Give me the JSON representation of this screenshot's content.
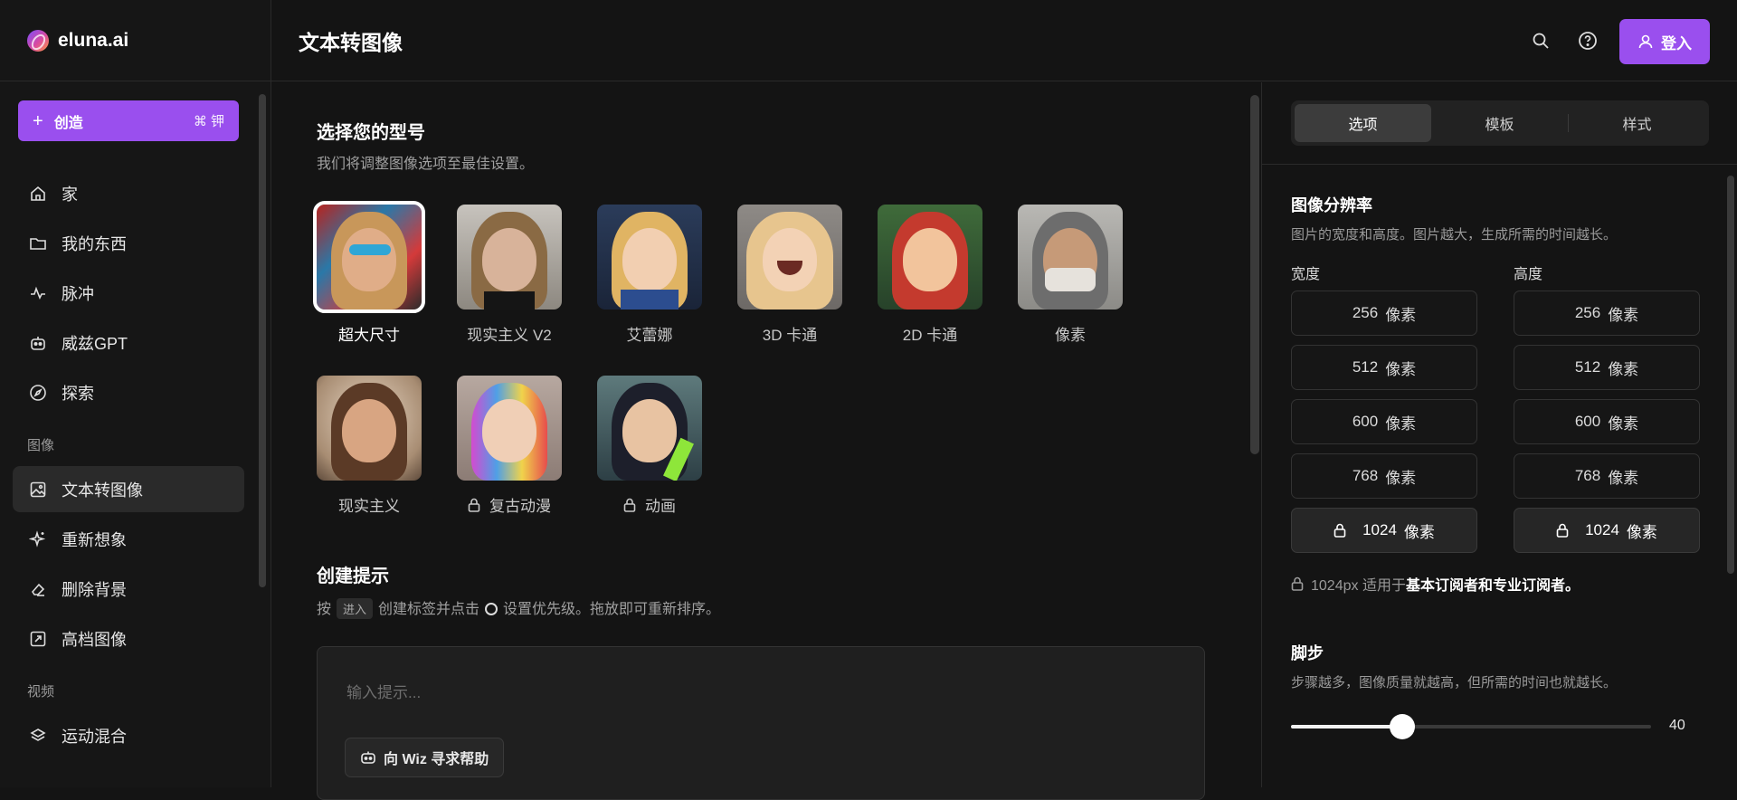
{
  "brand": {
    "name": "eluna.ai"
  },
  "header": {
    "title": "文本转图像",
    "login_label": "登入"
  },
  "sidebar": {
    "create_label": "创造",
    "create_shortcut": "⌘ 钾",
    "items": [
      {
        "label": "家",
        "icon": "home-icon"
      },
      {
        "label": "我的东西",
        "icon": "folder-icon"
      },
      {
        "label": "脉冲",
        "icon": "pulse-icon"
      },
      {
        "label": "威兹GPT",
        "icon": "robot-icon"
      },
      {
        "label": "探索",
        "icon": "compass-icon"
      }
    ],
    "section_image": "图像",
    "image_items": [
      {
        "label": "文本转图像",
        "icon": "image-icon",
        "active": true
      },
      {
        "label": "重新想象",
        "icon": "sparkle-icon"
      },
      {
        "label": "删除背景",
        "icon": "eraser-icon"
      },
      {
        "label": "高档图像",
        "icon": "upscale-icon"
      }
    ],
    "section_video": "视频",
    "video_items": [
      {
        "label": "运动混合",
        "icon": "layers-icon"
      }
    ]
  },
  "main": {
    "model_title": "选择您的型号",
    "model_subtitle": "我们将调整图像选项至最佳设置。",
    "models": [
      {
        "label": "超大尺寸",
        "selected": true,
        "locked": false
      },
      {
        "label": "现实主义 V2",
        "selected": false,
        "locked": false
      },
      {
        "label": "艾蕾娜",
        "selected": false,
        "locked": false
      },
      {
        "label": "3D 卡通",
        "selected": false,
        "locked": false
      },
      {
        "label": "2D 卡通",
        "selected": false,
        "locked": false
      },
      {
        "label": "像素",
        "selected": false,
        "locked": false
      },
      {
        "label": "现实主义",
        "selected": false,
        "locked": false
      },
      {
        "label": "复古动漫",
        "selected": false,
        "locked": true
      },
      {
        "label": "动画",
        "selected": false,
        "locked": true
      }
    ],
    "prompt_title": "创建提示",
    "prompt_hint_pre": "按",
    "prompt_hint_key": "进入",
    "prompt_hint_mid": "创建标签并点击",
    "prompt_hint_post": "设置优先级。拖放即可重新排序。",
    "prompt_placeholder": "输入提示...",
    "wiz_label": "向 Wiz 寻求帮助"
  },
  "right": {
    "tabs": [
      {
        "label": "选项",
        "active": true
      },
      {
        "label": "模板",
        "active": false
      },
      {
        "label": "样式",
        "active": false
      }
    ],
    "resolution_title": "图像分辨率",
    "resolution_subtitle": "图片的宽度和高度。图片越大，生成所需的时间越长。",
    "width_label": "宽度",
    "height_label": "高度",
    "unit": "像素",
    "width_options": [
      {
        "value": "256",
        "locked": false
      },
      {
        "value": "512",
        "locked": false
      },
      {
        "value": "600",
        "locked": false
      },
      {
        "value": "768",
        "locked": false
      },
      {
        "value": "1024",
        "locked": true
      }
    ],
    "height_options": [
      {
        "value": "256",
        "locked": false
      },
      {
        "value": "512",
        "locked": false
      },
      {
        "value": "600",
        "locked": false
      },
      {
        "value": "768",
        "locked": false
      },
      {
        "value": "1024",
        "locked": true
      }
    ],
    "note_pre": "1024px 适用于",
    "note_bold": "基本订阅者和专业订阅者。",
    "steps_title": "脚步",
    "steps_subtitle": "步骤越多，图像质量就越高，但所需的时间也就越长。",
    "steps_value": "40",
    "steps_fraction": 0.31
  },
  "colors": {
    "accent": "#9a4fee",
    "background": "#141414",
    "panel": "#161616"
  }
}
